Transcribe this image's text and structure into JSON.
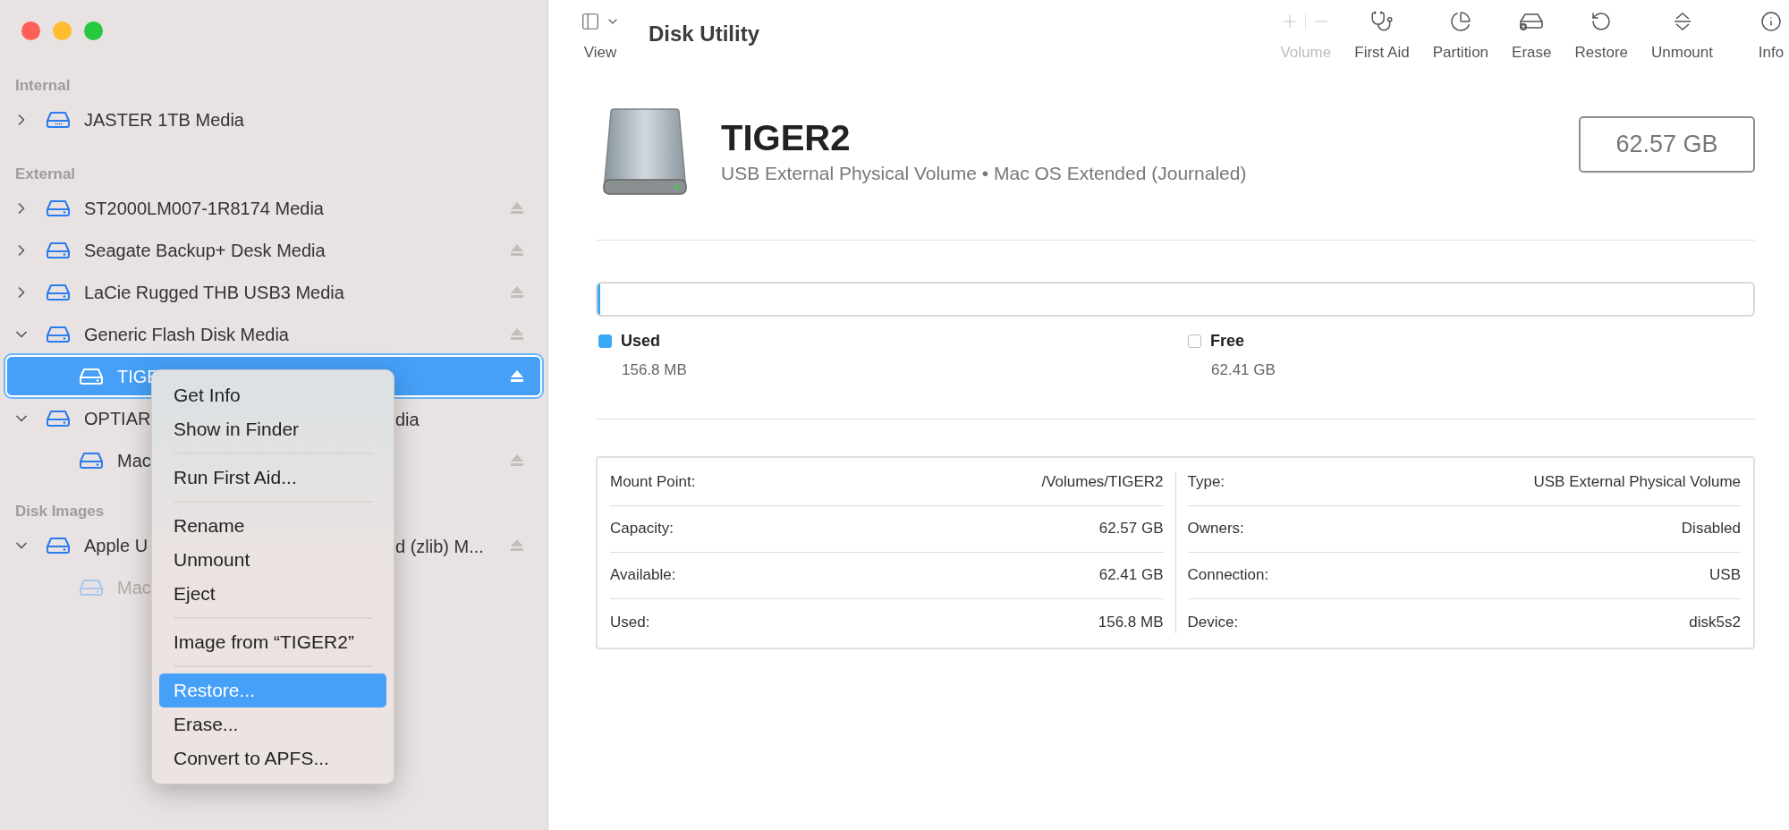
{
  "sidebar": {
    "sections": [
      {
        "title": "Internal",
        "items": [
          {
            "label": "JASTER 1TB Media",
            "kind": "internal",
            "expanded": false,
            "selected": false,
            "dimmed": false,
            "eject": false
          }
        ]
      },
      {
        "title": "External",
        "items": [
          {
            "label": "ST2000LM007-1R8174 Media",
            "kind": "external",
            "expanded": false,
            "selected": false,
            "dimmed": false,
            "eject": true
          },
          {
            "label": "Seagate Backup+ Desk Media",
            "kind": "external",
            "expanded": false,
            "selected": false,
            "dimmed": false,
            "eject": true
          },
          {
            "label": "LaCie Rugged THB USB3 Media",
            "kind": "external",
            "expanded": false,
            "selected": false,
            "dimmed": false,
            "eject": true
          },
          {
            "label": "Generic Flash Disk Media",
            "kind": "external",
            "expanded": true,
            "selected": false,
            "dimmed": false,
            "eject": true,
            "children": [
              {
                "label": "TIGE",
                "kind": "external",
                "selected": true,
                "dimmed": false,
                "eject": true
              }
            ]
          },
          {
            "label": "OPTIAR",
            "label_tail": "dia",
            "kind": "external",
            "expanded": true,
            "selected": false,
            "dimmed": false,
            "eject": false,
            "children": [
              {
                "label": "Mac",
                "kind": "external",
                "selected": false,
                "dimmed": false,
                "eject": true
              }
            ]
          }
        ]
      },
      {
        "title": "Disk Images",
        "items": [
          {
            "label": "Apple U",
            "label_tail": "d (zlib) M...",
            "kind": "external",
            "expanded": true,
            "selected": false,
            "dimmed": false,
            "eject": true,
            "children": [
              {
                "label": "Mac",
                "kind": "external",
                "selected": false,
                "dimmed": true,
                "eject": false
              }
            ]
          }
        ]
      }
    ]
  },
  "context_menu": {
    "groups": [
      [
        {
          "label": "Get Info",
          "selected": false
        },
        {
          "label": "Show in Finder",
          "selected": false
        }
      ],
      [
        {
          "label": "Run First Aid...",
          "selected": false
        }
      ],
      [
        {
          "label": "Rename",
          "selected": false
        },
        {
          "label": "Unmount",
          "selected": false
        },
        {
          "label": "Eject",
          "selected": false
        }
      ],
      [
        {
          "label": "Image from “TIGER2”",
          "selected": false
        }
      ],
      [
        {
          "label": "Restore...",
          "selected": true
        },
        {
          "label": "Erase...",
          "selected": false
        },
        {
          "label": "Convert to APFS...",
          "selected": false
        }
      ]
    ]
  },
  "toolbar": {
    "view_label": "View",
    "title": "Disk Utility",
    "buttons": [
      {
        "kind": "volume",
        "label": "Volume",
        "disabled": true
      },
      {
        "kind": "firstaid",
        "label": "First Aid",
        "disabled": false
      },
      {
        "kind": "partition",
        "label": "Partition",
        "disabled": false
      },
      {
        "kind": "erase",
        "label": "Erase",
        "disabled": false
      },
      {
        "kind": "restore",
        "label": "Restore",
        "disabled": false
      },
      {
        "kind": "unmount",
        "label": "Unmount",
        "disabled": false
      },
      {
        "kind": "info",
        "label": "Info",
        "disabled": false
      }
    ]
  },
  "volume": {
    "name": "TIGER2",
    "subtitle": "USB External Physical Volume • Mac OS Extended (Journaled)",
    "capacity": "62.57 GB"
  },
  "usage": {
    "level": 0.0025,
    "legend": [
      {
        "label": "Used",
        "value": "156.8 MB",
        "color": "#3aa9f4"
      },
      {
        "label": "Free",
        "value": "62.41 GB",
        "color": "#ffffff"
      }
    ]
  },
  "details": {
    "left": [
      {
        "label": "Mount Point:",
        "value": "/Volumes/TIGER2"
      },
      {
        "label": "Capacity:",
        "value": "62.57 GB"
      },
      {
        "label": "Available:",
        "value": "62.41 GB"
      },
      {
        "label": "Used:",
        "value": "156.8 MB"
      }
    ],
    "right": [
      {
        "label": "Type:",
        "value": "USB External Physical Volume"
      },
      {
        "label": "Owners:",
        "value": "Disabled"
      },
      {
        "label": "Connection:",
        "value": "USB"
      },
      {
        "label": "Device:",
        "value": "disk5s2"
      }
    ]
  }
}
